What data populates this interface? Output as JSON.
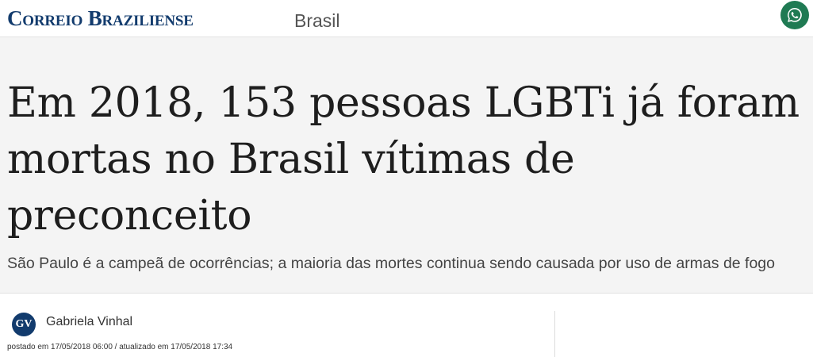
{
  "header": {
    "logo_text": "Correio Braziliense",
    "section_label": "Brasil",
    "share_icon": "whatsapp-icon",
    "share_color": "#1f7a53",
    "brand_color": "#123b6d"
  },
  "article": {
    "headline": "Em 2018, 153 pessoas LGBTi já foram mortas no Brasil vítimas de preconceito",
    "subtitle": "São Paulo é a campeã de ocorrências; a maioria das mortes continua sendo causada por uso de armas de fogo"
  },
  "author": {
    "initials": "GV",
    "name": "Gabriela Vinhal",
    "dates": "postado em 17/05/2018 06:00 / atualizado em 17/05/2018 17:34"
  }
}
